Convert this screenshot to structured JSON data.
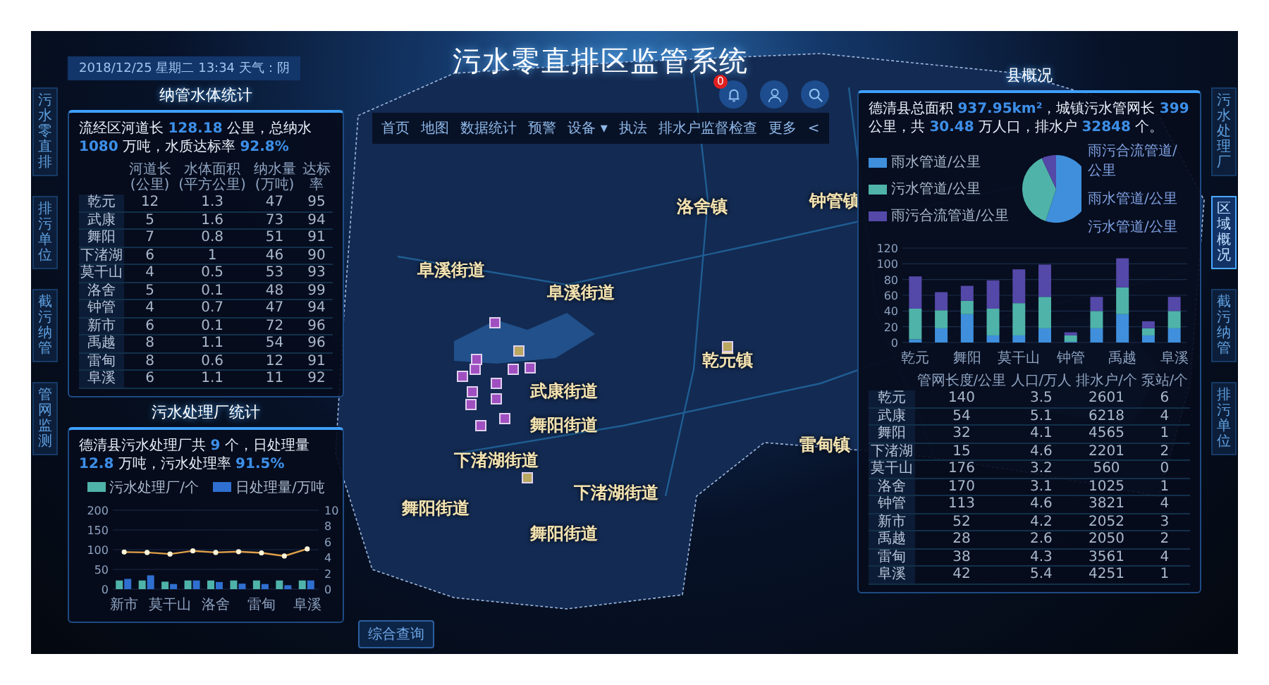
{
  "header": {
    "datetime": "2018/12/25 星期二 13:34 天气：阴",
    "title": "污水零直排区监管系统",
    "alert_count": "0"
  },
  "nav": [
    {
      "label": "首页"
    },
    {
      "label": "地图"
    },
    {
      "label": "数据统计"
    },
    {
      "label": "预警"
    },
    {
      "label": "设备 ▾"
    },
    {
      "label": "执法"
    },
    {
      "label": "排水户监督检查"
    },
    {
      "label": "更多"
    },
    {
      "label": "<"
    }
  ],
  "side_tabs_left": [
    {
      "label": "污水零直排",
      "selected": false
    },
    {
      "label": "排污单位",
      "selected": false
    },
    {
      "label": "截污纳管",
      "selected": false
    },
    {
      "label": "管网监测",
      "selected": false
    }
  ],
  "side_tabs_right": [
    {
      "label": "污水处理厂",
      "selected": false
    },
    {
      "label": "区域概况",
      "selected": true
    },
    {
      "label": "截污纳管",
      "selected": false
    },
    {
      "label": "排污单位",
      "selected": false
    }
  ],
  "water_stats": {
    "title": "纳管水体统计",
    "summary": [
      {
        "text": "流经区河道长 ",
        "highlight": false
      },
      {
        "text": "128.18",
        "highlight": true
      },
      {
        "text": " 公里，总纳水 ",
        "highlight": false
      },
      {
        "text": "1080",
        "highlight": true
      },
      {
        "text": " 万吨，水质达标率 ",
        "highlight": false
      },
      {
        "text": "92.8%",
        "highlight": true
      }
    ],
    "table": {
      "columns": [
        "",
        "河道长(公里)",
        "水体面积(平方公里)",
        "纳水量(万吨)",
        "达标率"
      ],
      "rows": [
        [
          "乾元",
          "12",
          "1.3",
          "47",
          "95"
        ],
        [
          "武康",
          "5",
          "1.6",
          "73",
          "94"
        ],
        [
          "舞阳",
          "7",
          "0.8",
          "51",
          "91"
        ],
        [
          "下渚湖",
          "6",
          "1",
          "46",
          "90"
        ],
        [
          "莫干山",
          "4",
          "0.5",
          "53",
          "93"
        ],
        [
          "洛舍",
          "5",
          "0.1",
          "48",
          "99"
        ],
        [
          "钟管",
          "4",
          "0.7",
          "47",
          "94"
        ],
        [
          "新市",
          "6",
          "0.1",
          "72",
          "96"
        ],
        [
          "禹越",
          "8",
          "1.1",
          "54",
          "96"
        ],
        [
          "雷甸",
          "8",
          "0.6",
          "12",
          "91"
        ],
        [
          "阜溪",
          "6",
          "1.1",
          "11",
          "92"
        ]
      ]
    }
  },
  "plant_stats": {
    "title": "污水处理厂统计",
    "summary": [
      {
        "text": "德清县污水处理厂共 ",
        "highlight": false
      },
      {
        "text": "9",
        "highlight": true
      },
      {
        "text": " 个，日处理量 ",
        "highlight": false
      },
      {
        "text": "12.8",
        "highlight": true
      },
      {
        "text": " 万吨，污水处理率 ",
        "highlight": false
      },
      {
        "text": "91.5%",
        "highlight": true
      }
    ],
    "chart_data": {
      "type": "bar",
      "stacked": false,
      "grid": true,
      "categories": [
        "新市",
        null,
        "莫干山",
        null,
        "洛舍",
        null,
        "雷甸",
        null,
        "阜溪"
      ],
      "ylim": [
        0,
        200
      ],
      "yticks": [
        0,
        50,
        100,
        150,
        200
      ],
      "y2lim": [
        0,
        10
      ],
      "y2ticks": [
        0,
        2,
        4,
        6,
        8,
        10
      ],
      "series": [
        {
          "name": "污水处理厂/个",
          "color": "#4fb3a9",
          "values": [
            22,
            22,
            19,
            22,
            22,
            22,
            22,
            22,
            22
          ]
        },
        {
          "name": "日处理量/万吨",
          "color": "#2f6fd0",
          "values": [
            26,
            35,
            13,
            22,
            18,
            14,
            13,
            10,
            22
          ]
        },
        {
          "type": "line",
          "marker": true,
          "color": "#e0a04a",
          "values": [
            94,
            93,
            89,
            97,
            93,
            95,
            92,
            84,
            102
          ]
        }
      ]
    }
  },
  "county": {
    "title": "县概况",
    "summary": [
      {
        "text": "德清县总面积 ",
        "highlight": false
      },
      {
        "text": "937.95km²",
        "highlight": true
      },
      {
        "text": "，城镇污水管网长 ",
        "highlight": false
      },
      {
        "text": "399",
        "highlight": true
      },
      {
        "text": " 公里，共 ",
        "highlight": false
      },
      {
        "text": "30.48",
        "highlight": true
      },
      {
        "text": " 万人口，排水户 ",
        "highlight": false
      },
      {
        "text": "32848",
        "highlight": true
      },
      {
        "text": " 个。",
        "highlight": false
      }
    ],
    "pie_legend": [
      {
        "label": "雨水管道/公里",
        "color": "#3f8fdc"
      },
      {
        "label": "污水管道/公里",
        "color": "#4fb3a9"
      },
      {
        "label": "雨污合流管道/公里",
        "color": "#5448a8"
      }
    ],
    "pie_labels": [
      "雨污合流管道/公里",
      "雨水管道/公里",
      "污水管道/公里"
    ],
    "chart_data": {
      "type": "bar",
      "stacked": true,
      "grid": true,
      "categories": [
        "乾元",
        null,
        "舞阳",
        null,
        "莫干山",
        null,
        "钟管",
        null,
        "禹越",
        null,
        "阜溪"
      ],
      "ylim": [
        0,
        120
      ],
      "yticks": [
        0,
        20,
        40,
        60,
        80,
        100,
        120
      ],
      "series": [
        {
          "color": "#3f8fdc",
          "values": [
            4,
            18,
            36,
            9,
            9,
            18,
            1,
            18,
            36,
            9,
            18
          ]
        },
        {
          "color": "#4fb3a9",
          "values": [
            39,
            23,
            17,
            34,
            41,
            40,
            8,
            22,
            34,
            9,
            22
          ]
        },
        {
          "color": "#5448a8",
          "values": [
            41,
            23,
            19,
            36,
            43,
            41,
            4,
            18,
            37,
            9,
            18
          ]
        }
      ]
    },
    "table": {
      "columns": [
        "",
        "管网长度/公里",
        "人口/万人",
        "排水户/个",
        "泵站/个"
      ],
      "rows": [
        [
          "乾元",
          "140",
          "3.5",
          "2601",
          "6"
        ],
        [
          "武康",
          "54",
          "5.1",
          "6218",
          "4"
        ],
        [
          "舞阳",
          "32",
          "4.1",
          "4565",
          "1"
        ],
        [
          "下渚湖",
          "15",
          "4.6",
          "2201",
          "2"
        ],
        [
          "莫干山",
          "176",
          "3.2",
          "560",
          "0"
        ],
        [
          "洛舍",
          "170",
          "3.1",
          "1025",
          "1"
        ],
        [
          "钟管",
          "113",
          "4.6",
          "3821",
          "4"
        ],
        [
          "新市",
          "52",
          "4.2",
          "2052",
          "3"
        ],
        [
          "禹越",
          "28",
          "2.6",
          "2050",
          "2"
        ],
        [
          "雷甸",
          "38",
          "4.3",
          "3561",
          "4"
        ],
        [
          "阜溪",
          "42",
          "5.4",
          "4251",
          "1"
        ]
      ]
    }
  },
  "map": {
    "labels": [
      "阜溪街道",
      "阜溪街道",
      "洛舍镇",
      "钟管镇",
      "乾元镇",
      "武康街道",
      "舞阳街道",
      "下渚湖街道",
      "下渚湖街道",
      "舞阳街道",
      "舞阳街道",
      "雷甸镇"
    ],
    "markers": [
      {
        "kind": "monitor"
      },
      {
        "kind": "monitor"
      },
      {
        "kind": "monitor"
      },
      {
        "kind": "monitor"
      },
      {
        "kind": "monitor"
      },
      {
        "kind": "monitor"
      },
      {
        "kind": "monitor"
      },
      {
        "kind": "monitor"
      },
      {
        "kind": "monitor"
      },
      {
        "kind": "monitor"
      },
      {
        "kind": "monitor"
      },
      {
        "kind": "monitor"
      },
      {
        "kind": "station"
      },
      {
        "kind": "station"
      },
      {
        "kind": "station"
      }
    ]
  },
  "bottom_button": "综合查询"
}
